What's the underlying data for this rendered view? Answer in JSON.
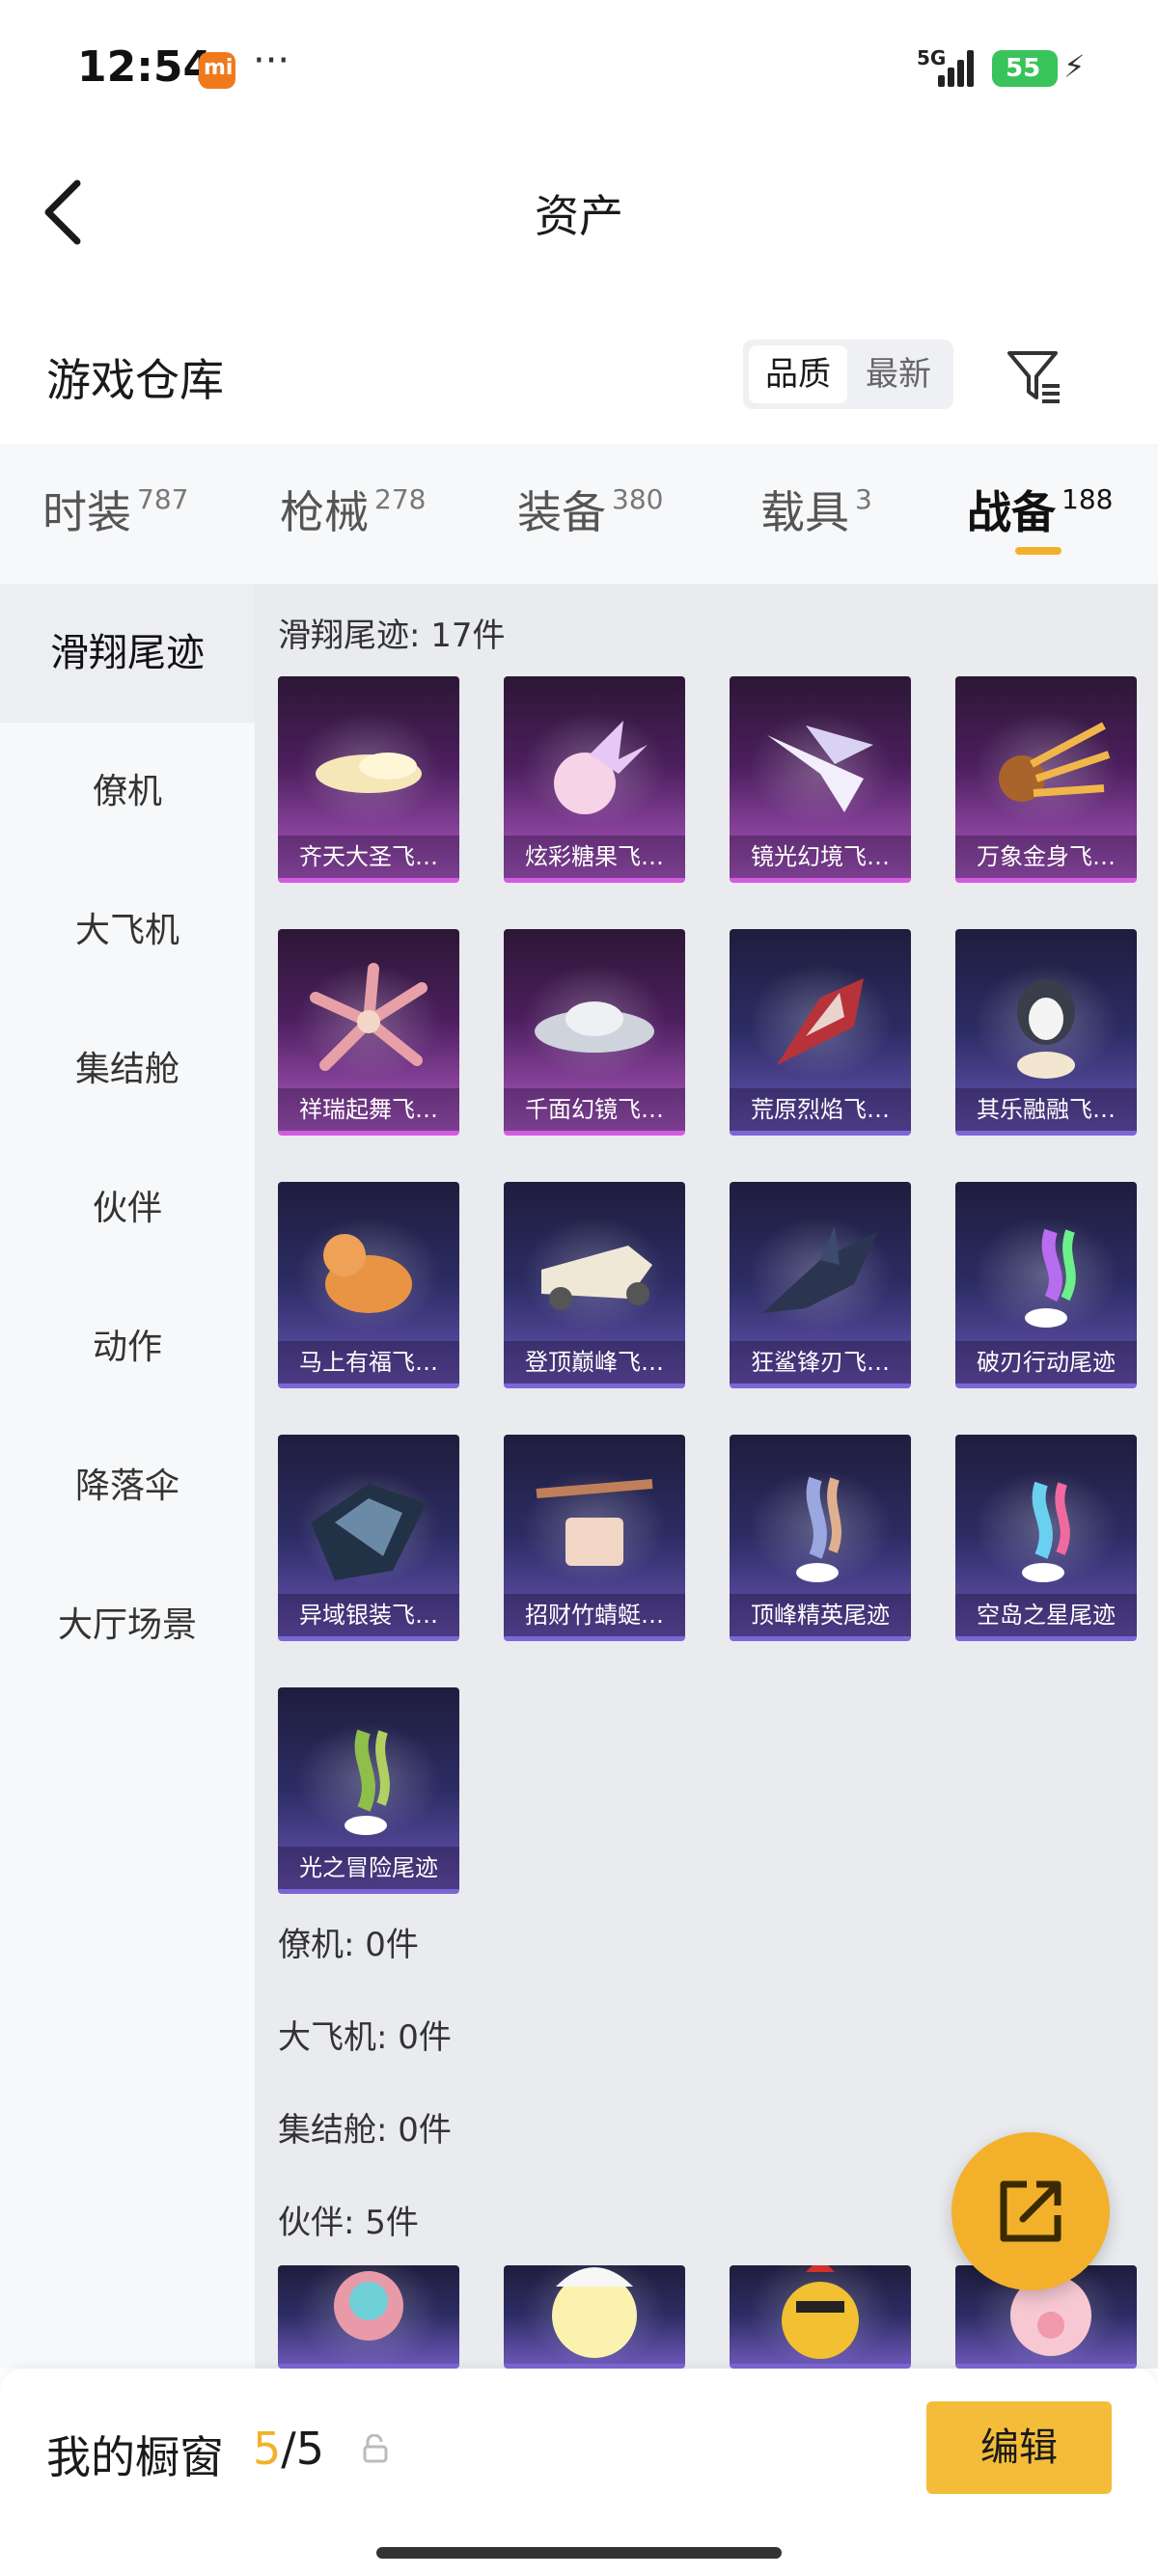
{
  "status_bar": {
    "time": "12:54",
    "network": "5G",
    "battery": "55"
  },
  "header": {
    "title": "资产"
  },
  "warehouse": {
    "title": "游戏仓库",
    "sort_options": [
      "品质",
      "最新"
    ],
    "active_sort": "品质"
  },
  "tabs": [
    {
      "label": "时装",
      "count": "787"
    },
    {
      "label": "枪械",
      "count": "278"
    },
    {
      "label": "装备",
      "count": "380"
    },
    {
      "label": "载具",
      "count": "3"
    },
    {
      "label": "战备",
      "count": "188"
    }
  ],
  "active_tab": "战备",
  "sidebar": {
    "items": [
      "滑翔尾迹",
      "僚机",
      "大飞机",
      "集结舱",
      "伙伴",
      "动作",
      "降落伞",
      "大厅场景"
    ],
    "active": "滑翔尾迹"
  },
  "sections": {
    "trail": {
      "label": "滑翔尾迹: 17件"
    },
    "wingman": {
      "label": "僚机: 0件"
    },
    "bigplane": {
      "label": "大飞机: 0件"
    },
    "pod": {
      "label": "集结舱: 0件"
    },
    "partner": {
      "label": "伙伴: 5件"
    }
  },
  "trail_items": [
    {
      "name": "齐天大圣飞…",
      "rarity": "purple",
      "icon": "cloud-trail-icon"
    },
    {
      "name": "炫彩糖果飞…",
      "rarity": "purple",
      "icon": "candy-glider-icon"
    },
    {
      "name": "镜光幻境飞…",
      "rarity": "purple",
      "icon": "wing-glider-icon"
    },
    {
      "name": "万象金身飞…",
      "rarity": "purple",
      "icon": "comet-glider-icon"
    },
    {
      "name": "祥瑞起舞飞…",
      "rarity": "purple",
      "icon": "flower-glider-icon"
    },
    {
      "name": "千面幻镜飞…",
      "rarity": "purple",
      "icon": "ufo-glider-icon"
    },
    {
      "name": "荒原烈焰飞…",
      "rarity": "blue",
      "icon": "flame-glider-icon"
    },
    {
      "name": "其乐融融飞…",
      "rarity": "blue",
      "icon": "penguin-glider-icon"
    },
    {
      "name": "马上有福飞…",
      "rarity": "blue",
      "icon": "horse-glider-icon"
    },
    {
      "name": "登顶巅峰飞…",
      "rarity": "blue",
      "icon": "jet-glider-icon"
    },
    {
      "name": "狂鲨锋刃飞…",
      "rarity": "blue",
      "icon": "shark-glider-icon"
    },
    {
      "name": "破刃行动尾迹",
      "rarity": "blue",
      "icon": "rainbow-trail-icon"
    },
    {
      "name": "异域银装飞…",
      "rarity": "blue",
      "icon": "silver-wing-icon"
    },
    {
      "name": "招财竹蜻蜓…",
      "rarity": "blue",
      "icon": "propeller-glider-icon"
    },
    {
      "name": "顶峰精英尾迹",
      "rarity": "blue",
      "icon": "smoke-trail-icon"
    },
    {
      "name": "空岛之星尾迹",
      "rarity": "blue",
      "icon": "star-trail-icon"
    },
    {
      "name": "光之冒险尾迹",
      "rarity": "blue",
      "icon": "green-trail-icon"
    }
  ],
  "partner_items": [
    {
      "icon": "bear-partner-icon"
    },
    {
      "icon": "chick-partner-icon"
    },
    {
      "icon": "rooster-partner-icon"
    },
    {
      "icon": "pig-partner-icon"
    }
  ],
  "bottom_bar": {
    "label": "我的橱窗",
    "current": "5",
    "total": "/5",
    "edit_label": "编辑"
  },
  "colors": {
    "accent": "#f3b12b",
    "purple_rarity": "#d25be0",
    "blue_rarity": "#7c66d6"
  }
}
